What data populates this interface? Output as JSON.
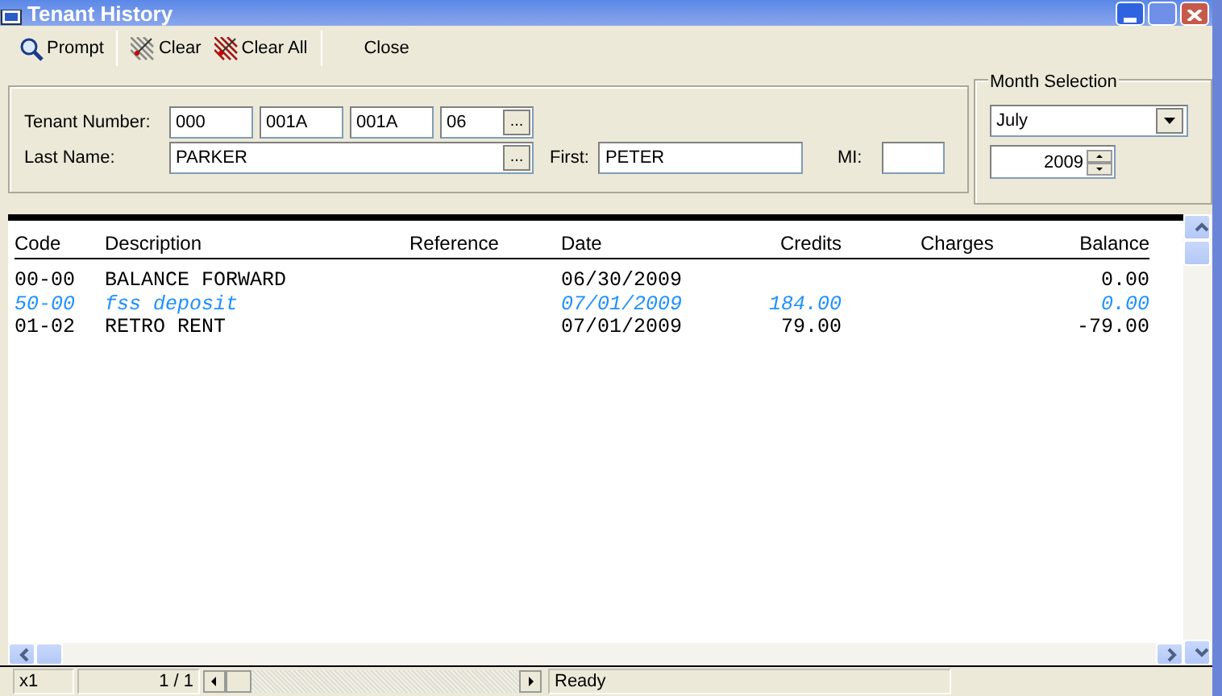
{
  "window": {
    "title": "Tenant History"
  },
  "toolbar": [
    {
      "label": "Prompt",
      "kind": "search"
    },
    {
      "label": "Clear",
      "kind": "clear"
    },
    {
      "label": "Clear All",
      "kind": "clearall"
    },
    {
      "label": "Close",
      "kind": "plain"
    }
  ],
  "tenant": {
    "number_label": "Tenant Number:",
    "number_parts": [
      "000",
      "001A",
      "001A",
      "06"
    ],
    "browse": "...",
    "last_label": "Last Name:",
    "last_name": "PARKER",
    "last_browse": "...",
    "first_label": "First:",
    "first_name": "PETER",
    "mi_label": "MI:"
  },
  "month_selection": {
    "title": "Month Selection",
    "month": "July",
    "year": "2009"
  },
  "table": {
    "columns": [
      "Code",
      "Description",
      "Reference",
      "Date",
      "Credits",
      "Charges",
      "Balance"
    ],
    "rows": [
      {
        "kind": "normal",
        "cells": [
          "00-00",
          "BALANCE FORWARD",
          "",
          "06/30/2009",
          "",
          "",
          "0.00"
        ]
      },
      {
        "kind": "memo",
        "cells": [
          "50-00",
          "fss deposit",
          "",
          "07/01/2009",
          "184.00",
          "",
          "0.00"
        ]
      },
      {
        "kind": "normal",
        "cells": [
          "01-02",
          "RETRO RENT",
          "",
          "07/01/2009",
          "79.00",
          "",
          "-79.00"
        ]
      }
    ]
  },
  "status_bar": {
    "zoom": "x1",
    "page": "1 / 1",
    "status": "Ready"
  }
}
